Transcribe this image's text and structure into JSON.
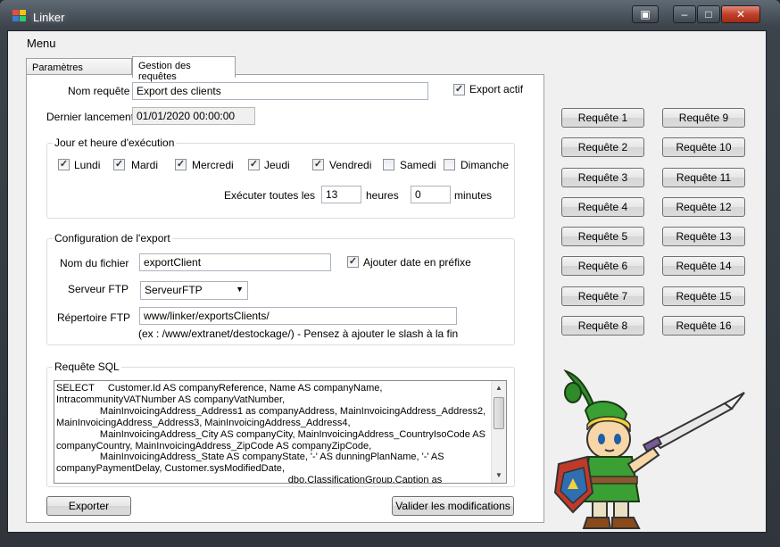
{
  "window": {
    "title": "Linker"
  },
  "menu": {
    "label": "Menu"
  },
  "tabs": [
    {
      "label": "Paramètres génériques"
    },
    {
      "label": "Gestion des requêtes"
    }
  ],
  "form": {
    "nom_requete_label": "Nom requête",
    "nom_requete_value": "Export des clients",
    "export_actif_label": "Export actif",
    "dernier_lancement_label": "Dernier lancement",
    "dernier_lancement_value": "01/01/2020 00:00:00"
  },
  "schedule": {
    "title": "Jour et heure d'exécution",
    "days": [
      {
        "label": "Lundi",
        "checked": true
      },
      {
        "label": "Mardi",
        "checked": true
      },
      {
        "label": "Mercredi",
        "checked": true
      },
      {
        "label": "Jeudi",
        "checked": true
      },
      {
        "label": "Vendredi",
        "checked": true
      },
      {
        "label": "Samedi",
        "checked": false
      },
      {
        "label": "Dimanche",
        "checked": false
      }
    ],
    "every_label": "Exécuter toutes les",
    "hours_value": "13",
    "hours_label": "heures",
    "minutes_value": "0",
    "minutes_label": "minutes"
  },
  "export_config": {
    "title": "Configuration de l'export",
    "filename_label": "Nom du fichier",
    "filename_value": "exportClient",
    "prefix_label": "Ajouter date en préfixe",
    "ftp_label": "Serveur FTP",
    "ftp_value": "ServeurFTP",
    "dir_label": "Répertoire FTP",
    "dir_value": "www/linker/exportsClients/",
    "dir_hint": "(ex : /www/extranet/destockage/) - Pensez à ajouter le slash à la fin"
  },
  "sql": {
    "title": "Requête SQL",
    "text": "SELECT     Customer.Id AS companyReference, Name AS companyName, IntracommunityVATNumber AS companyVatNumber,\n                MainInvoicingAddress_Address1 as companyAddress, MainInvoicingAddress_Address2, MainInvoicingAddress_Address3, MainInvoicingAddress_Address4,\n                MainInvoicingAddress_City AS companyCity, MainInvoicingAddress_CountryIsoCode AS companyCountry, MainInvoicingAddress_ZipCode AS companyZipCode,\n                MainInvoicingAddress_State AS companyState, '-' AS dunningPlanName, '-' AS companyPaymentDelay, Customer.sysModifiedDate,\n                                                                                     dbo.ClassificationGroup.Caption as"
  },
  "buttons": {
    "exporter": "Exporter",
    "valider": "Valider les modifications"
  },
  "requests": [
    "Requête 1",
    "Requête 2",
    "Requête 3",
    "Requête 4",
    "Requête 5",
    "Requête 6",
    "Requête 7",
    "Requête 8",
    "Requête 9",
    "Requête 10",
    "Requête 11",
    "Requête 12",
    "Requête 13",
    "Requête 14",
    "Requête 15",
    "Requête 16"
  ],
  "colors": {
    "titlebar": "#3c434b",
    "close_button": "#c2402b",
    "client_bg": "#f0f0f0"
  }
}
